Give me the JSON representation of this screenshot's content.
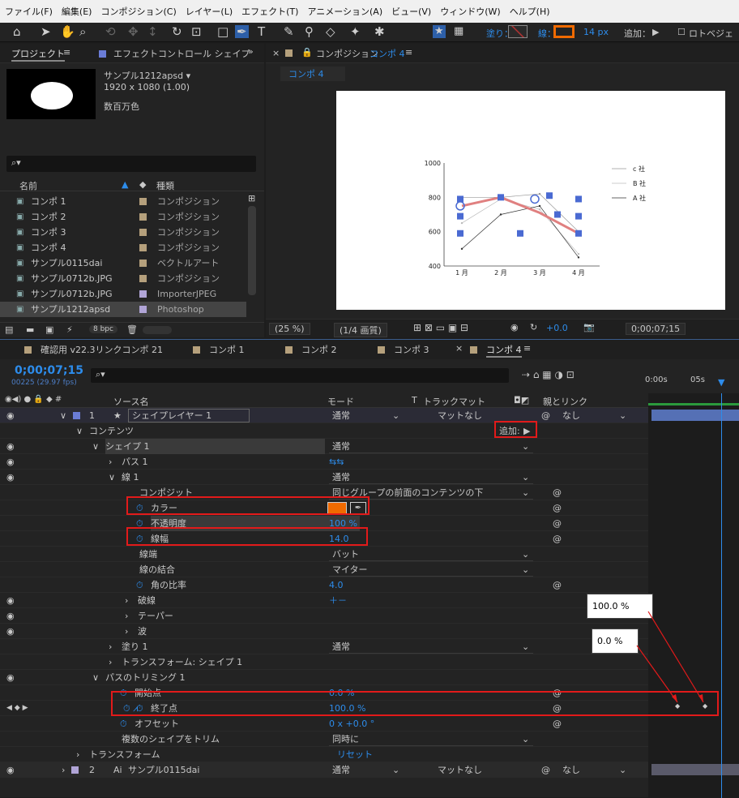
{
  "menu": [
    "ファイル(F)",
    "編集(E)",
    "コンポジション(C)",
    "レイヤー(L)",
    "エフェクト(T)",
    "アニメーション(A)",
    "ビュー(V)",
    "ウィンドウ(W)",
    "ヘルプ(H)"
  ],
  "toolbar": {
    "fill_label": "塗り：",
    "stroke_label": "線：",
    "stroke_width": "14 px",
    "add_label": "追加：",
    "bezier_label": "ロトベジェ",
    "stroke_color": "#f06a00"
  },
  "project": {
    "tab": "プロジェクト",
    "tab2": "エフェクトコントロール シェイプ",
    "item_name": "サンプル1212apsd ▾",
    "item_size": "1920 x 1080 (1.00)",
    "item_color": "数百万色",
    "col_name": "名前",
    "col_type": "種類",
    "bpc": "8 bpc",
    "items": [
      {
        "name": "コンポ 1",
        "type": "コンポジション",
        "color": "#b5a07c"
      },
      {
        "name": "コンポ 2",
        "type": "コンポジション",
        "color": "#b5a07c"
      },
      {
        "name": "コンポ 3",
        "type": "コンポジション",
        "color": "#b5a07c"
      },
      {
        "name": "コンポ 4",
        "type": "コンポジション",
        "color": "#b5a07c"
      },
      {
        "name": "サンプル0115dai",
        "type": "ベクトルアート",
        "color": "#b5a07c"
      },
      {
        "name": "サンプル0712b.JPG",
        "type": "コンポジション",
        "color": "#b5a07c"
      },
      {
        "name": "サンプル0712b.JPG",
        "type": "ImporterJPEG",
        "color": "#b0a4d6"
      },
      {
        "name": "サンプル1212apsd",
        "type": "Photoshop",
        "color": "#b0a4d6"
      }
    ]
  },
  "viewer": {
    "tab": "コンポジション",
    "tab_comp": "コンポ 4",
    "sub_tab": "コンポ 4",
    "zoom": "(25 %)",
    "quality": "(1/4 画質)",
    "exposure": "+0.0",
    "timecode": "0;00;07;15"
  },
  "chart_data": {
    "type": "line",
    "categories": [
      "1 月",
      "2 月",
      "3 月",
      "4 月"
    ],
    "ylim": [
      400,
      1000
    ],
    "yticks": [
      "1000",
      "800",
      "600",
      "400"
    ],
    "series": [
      {
        "name": "c 社",
        "values": [
          800,
          800,
          820,
          600
        ]
      },
      {
        "name": "B 社",
        "values": [
          650,
          790,
          730,
          470
        ]
      },
      {
        "name": "A 社",
        "values": [
          500,
          700,
          750,
          450
        ]
      }
    ],
    "highlight": {
      "values": [
        750,
        800,
        710,
        590
      ],
      "color": "#e08080"
    }
  },
  "timeline": {
    "tabs": [
      "確認用 v22.3リンクコンポ 21",
      "コンポ 1",
      "コンポ 2",
      "コンポ 3",
      "コンポ 4"
    ],
    "timecode": "0;00;07;15",
    "fps": "00225 (29.97 fps)",
    "headers": {
      "source": "ソース名",
      "mode": "モード",
      "track": "トラックマット",
      "parent": "親とリンク"
    },
    "ruler": [
      "0:00s",
      "05s"
    ],
    "layer1": {
      "num": "1",
      "name": "シェイプレイヤー 1",
      "mode": "通常",
      "matte": "マットなし",
      "parent": "なし"
    },
    "layer2": {
      "num": "2",
      "name": "サンプル0115dai",
      "mode": "通常",
      "matte": "マットなし",
      "parent": "なし"
    },
    "contents": "コンテンツ",
    "add": "追加:",
    "shape1": "シェイプ 1",
    "shape1_mode": "通常",
    "path1": "パス 1",
    "stroke1": "線 1",
    "stroke1_mode": "通常",
    "composite": "コンポジット",
    "composite_val": "同じグループの前面のコンテンツの下",
    "color": "カラー",
    "opacity": "不透明度",
    "opacity_val": "100 %",
    "width": "線幅",
    "width_val": "14.0",
    "cap": "線端",
    "cap_val": "バット",
    "join": "線の結合",
    "join_val": "マイター",
    "miter": "角の比率",
    "miter_val": "4.0",
    "dash": "破線",
    "taper": "テーパー",
    "wave": "波",
    "fill1": "塗り 1",
    "fill1_mode": "通常",
    "transform_shape": "トランスフォーム: シェイプ 1",
    "trim": "パスのトリミング 1",
    "start": "開始点",
    "start_val": "0.0 %",
    "end": "終了点",
    "end_val": "100.0 %",
    "offset": "オフセット",
    "offset_val": "0 x +0.0 °",
    "trim_multi": "複数のシェイプをトリム",
    "trim_multi_val": "同時に",
    "transform": "トランスフォーム",
    "reset": "リセット"
  },
  "callouts": {
    "a": "100.0 %",
    "b": "0.0 %"
  }
}
